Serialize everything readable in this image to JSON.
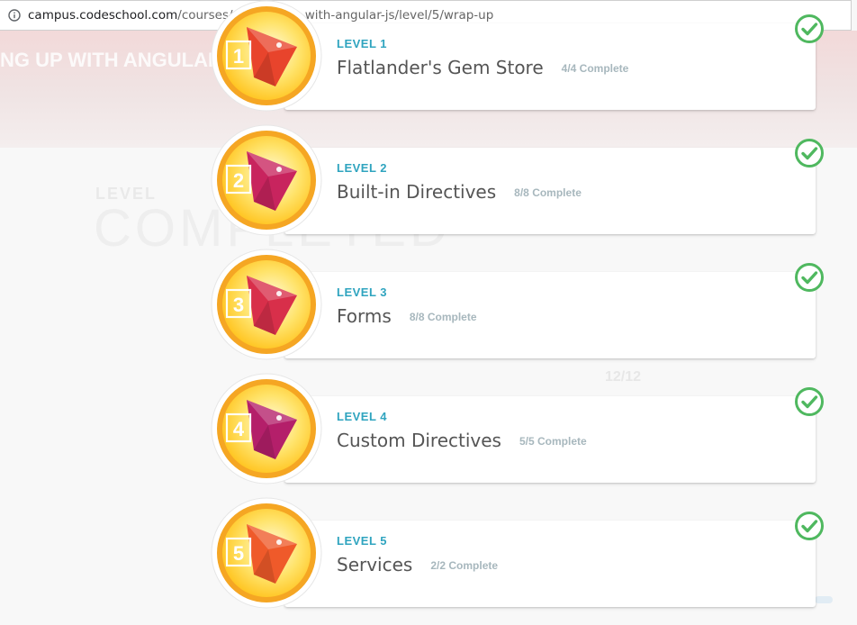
{
  "browser": {
    "url_host": "campus.codeschool.com",
    "url_path": "/courses/shaping-up-with-angular-js/level/5/wrap-up"
  },
  "background": {
    "course_title": "NG UP WITH ANGULAR",
    "level_word": "LEVEL",
    "completed_word": "COMPLETED",
    "count": "12/12"
  },
  "colors": {
    "accent": "#2fa4bf",
    "check": "#4fb85f",
    "badge_outer": "#f5a623",
    "badge_inner": "#ffd64a"
  },
  "levels": [
    {
      "label": "LEVEL 1",
      "title": "Flatlander's Gem Store",
      "status": "4/4 Complete",
      "number": "1",
      "gem_color": "#e8442c"
    },
    {
      "label": "LEVEL 2",
      "title": "Built-in Directives",
      "status": "8/8 Complete",
      "number": "2",
      "gem_color": "#c8245e"
    },
    {
      "label": "LEVEL 3",
      "title": "Forms",
      "status": "8/8 Complete",
      "number": "3",
      "gem_color": "#d82f4a"
    },
    {
      "label": "LEVEL 4",
      "title": "Custom Directives",
      "status": "5/5 Complete",
      "number": "4",
      "gem_color": "#b41f6a"
    },
    {
      "label": "LEVEL 5",
      "title": "Services",
      "status": "2/2 Complete",
      "number": "5",
      "gem_color": "#ef5a2a"
    }
  ]
}
